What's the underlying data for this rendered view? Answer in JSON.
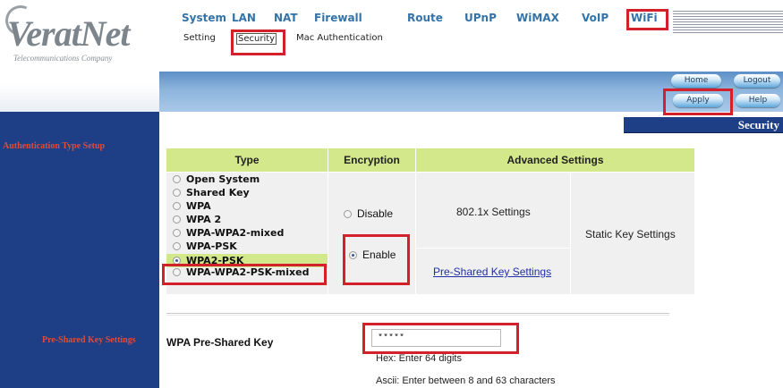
{
  "logo": {
    "brand": "VeratNet",
    "tagline": "Telecommunications Company"
  },
  "top_nav": [
    "System",
    "LAN",
    "NAT",
    "Firewall",
    "Route",
    "UPnP",
    "WiMAX",
    "VoIP",
    "WiFi"
  ],
  "sub_nav": [
    "Setting",
    "Security",
    "Mac Authentication"
  ],
  "buttons": {
    "home": "Home",
    "logout": "Logout",
    "apply": "Apply",
    "help": "Help"
  },
  "sidebar": {
    "title": "Security",
    "auth_label": "Authentication Type Setup",
    "psk_label": "Pre-Shared Key Settings"
  },
  "table": {
    "headers": [
      "Type",
      "Encryption",
      "Advanced Settings"
    ],
    "types": [
      "Open System",
      "Shared Key",
      "WPA",
      "WPA 2",
      "WPA-WPA2-mixed",
      "WPA-PSK",
      "WPA2-PSK",
      "WPA-WPA2-PSK-mixed"
    ],
    "selected_type": "WPA2-PSK",
    "encryption": [
      "Disable",
      "Enable"
    ],
    "selected_encryption": "Enable",
    "advanced": {
      "dot1x": "802.1x Settings",
      "static_key": "Static Key Settings",
      "psk_link": "Pre-Shared Key Settings"
    }
  },
  "psk": {
    "label": "WPA Pre-Shared Key",
    "value": "*****",
    "hex_hint": "Hex: Enter 64 digits",
    "ascii_hint": "Ascii: Enter between 8 and 63 characters"
  },
  "colors": {
    "nav_text": "#3473a7",
    "sidebar_bg": "#1e3e86",
    "sidebar_label": "#e04b3a",
    "header_green": "#d2e88a",
    "highlight_red": "#d3202a",
    "link": "#1f2fa6"
  }
}
